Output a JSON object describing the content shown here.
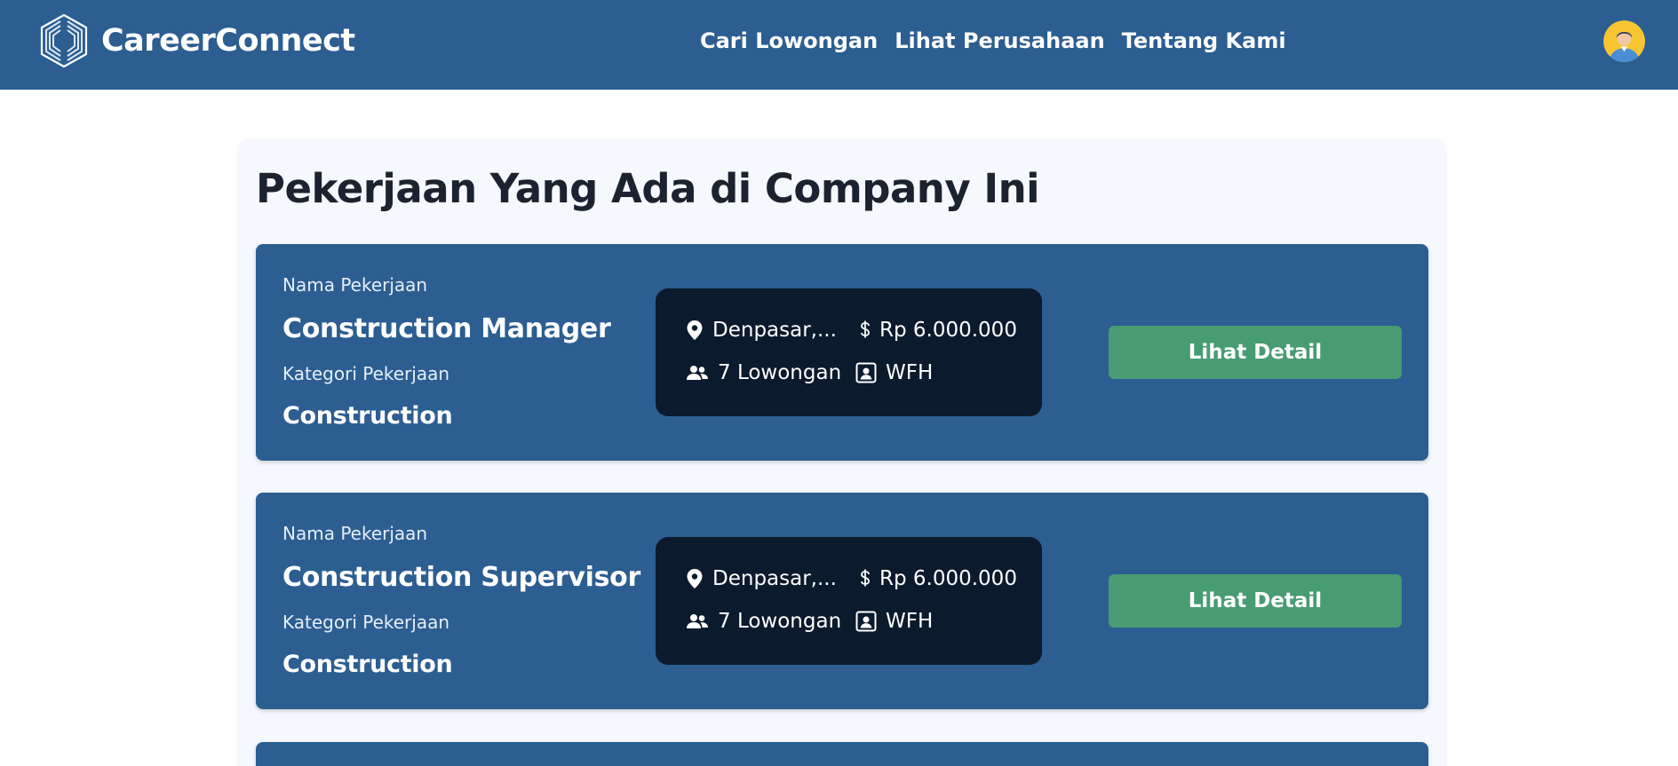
{
  "brand": {
    "name": "CareerConnect"
  },
  "nav": {
    "links": [
      {
        "label": "Cari Lowongan"
      },
      {
        "label": "Lihat Perusahaan"
      },
      {
        "label": "Tentang Kami"
      }
    ]
  },
  "page": {
    "title": "Pekerjaan Yang Ada di Company Ini"
  },
  "labels": {
    "job_name": "Nama Pekerjaan",
    "job_category": "Kategori Pekerjaan",
    "detail_button": "Lihat Detail"
  },
  "jobs": [
    {
      "name": "Construction Manager",
      "category": "Construction",
      "location": "Denpasar,...",
      "salary": "Rp 6.000.000",
      "vacancies": "7 Lowongan",
      "work_type": "WFH"
    },
    {
      "name": "Construction Supervisor",
      "category": "Construction",
      "location": "Denpasar,...",
      "salary": "Rp 6.000.000",
      "vacancies": "7 Lowongan",
      "work_type": "WFH"
    }
  ],
  "icons": {
    "logo": "hexagon-chevrons-logo-icon",
    "location": "map-pin-icon",
    "salary": "dollar-icon",
    "vacancies": "users-icon",
    "work_type": "remote-work-icon",
    "avatar": "user-avatar-icon"
  },
  "colors": {
    "navbar": "#2c5e91",
    "card": "#2c5e91",
    "info_box": "#0b1a2c",
    "button": "#489c72",
    "panel": "#f5f8fc",
    "title_text": "#1b2330"
  }
}
